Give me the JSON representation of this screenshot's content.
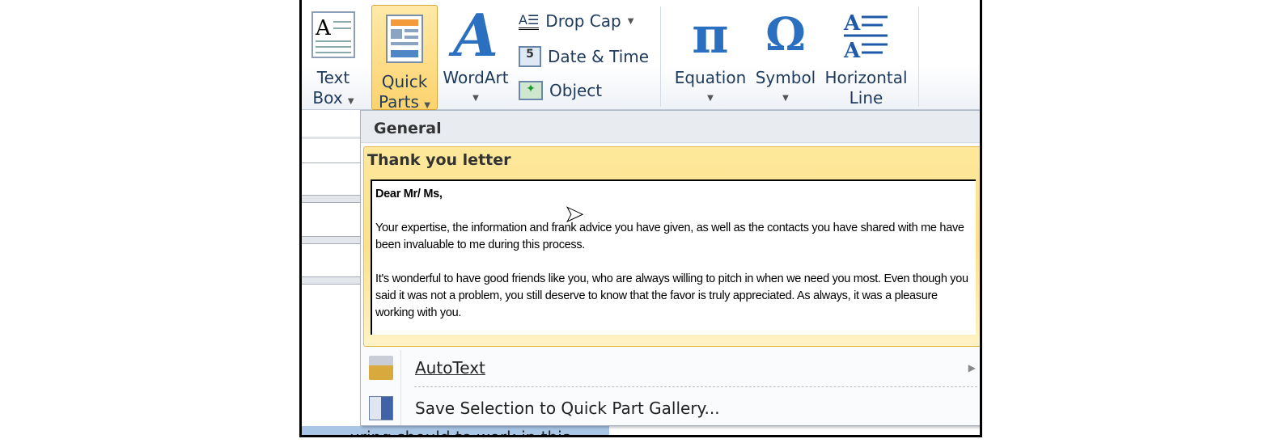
{
  "ribbon": {
    "text_box": [
      "Text",
      "Box"
    ],
    "quick_parts": [
      "Quick",
      "Parts"
    ],
    "wordart": "WordArt",
    "drop_cap": "Drop Cap",
    "date_time": "Date & Time",
    "object": "Object",
    "equation": "Equation",
    "symbol": "Symbol",
    "horizontal_line": [
      "Horizontal",
      "Line"
    ]
  },
  "menu": {
    "section": "General",
    "item_title": "Thank you letter",
    "preview": [
      "Dear Mr/ Ms,",
      "Your expertise, the information and frank advice you have given, as well as the contacts you have shared with me have been invaluable to me during this process.",
      "It's wonderful to have good friends like you, who are always willing to pitch in when we need you most. Even though you said it was not a problem, you still deserve to know that the favor is truly appreciated. As always, it was a pleasure working with you."
    ],
    "autotext": "AutoText",
    "save_selection": "Save Selection to Quick Part Gallery..."
  },
  "doc": {
    "bottom_text": "...uring should to work in this..."
  },
  "colors": {
    "accent": "#fcd36e",
    "ribbon_text": "#1e3a5c",
    "icon_blue": "#2b6fc0"
  }
}
